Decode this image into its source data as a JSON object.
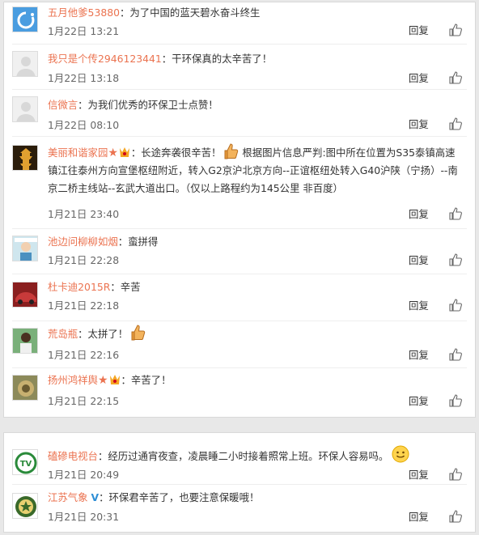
{
  "reply_label": "回复",
  "comments": [
    {
      "user": "五月他爹53880",
      "text": "：为了中国的蓝天碧水奋斗终生",
      "time": "1月22日 13:21"
    },
    {
      "user": "我只是个传2946123441",
      "text": "：干环保真的太辛苦了！",
      "time": "1月22日 13:18"
    },
    {
      "user": "信微言",
      "text": "：为我们优秀的环保卫士点赞！",
      "time": "1月22日 08:10"
    },
    {
      "user": "美丽和谐家园",
      "text_a": "：长途奔袭很辛苦！",
      "text_b": "根据图片信息严判:图中所在位置为S35泰镇高速镇江往泰州方向宣堡枢纽附近，转入G2京沪北京方向--正谊枢纽处转入G40沪陕（宁扬）--南京二桥主线站--玄武大道出口。（仅以上路程约为145公里 非百度）",
      "time": "1月21日 23:40"
    },
    {
      "user": "池边问柳柳如烟",
      "text": "：蛮拼得",
      "time": "1月21日 22:28"
    },
    {
      "user": "杜卡迪2015R",
      "text": "：辛苦",
      "time": "1月21日 22:18"
    },
    {
      "user": "荒岛瓶",
      "text": "：太拼了！",
      "time": "1月21日 22:16"
    },
    {
      "user": "扬州鸿祥舆",
      "text": "：辛苦了！",
      "time": "1月21日 22:15"
    }
  ],
  "comments2": [
    {
      "user": "磕磣电视台",
      "text": "：经历过通宵夜查，凌晨睡二小时接着照常上班。环保人容易吗。",
      "time": "1月21日 20:49"
    },
    {
      "user": "江苏气象",
      "text": "：环保君辛苦了，也要注意保暖哦！",
      "time": "1月21日 20:31"
    }
  ],
  "colors": {
    "username": "#eb7350",
    "text": "#333333",
    "verified": "#2f8fd6"
  }
}
